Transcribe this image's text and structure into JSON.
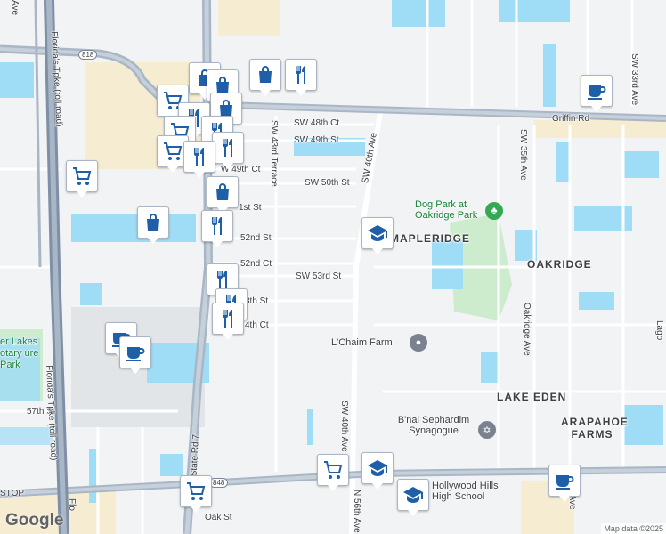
{
  "map": {
    "colors": {
      "land": "#f1f3f4",
      "water": "#9fdcf6",
      "road": "#ffffff",
      "highway": "#a9b6c6",
      "park": "#cdeccd",
      "urban": "#f6ecd1",
      "poi_blue": "#1e5fa8",
      "park_green": "#34a853"
    },
    "streets": {
      "sw48": "SW 48th Ct",
      "sw49": "SW 49th St",
      "sw49ct": "W 49th Ct",
      "sw50": "SW 50th St",
      "sw51": "1st St",
      "sw52": "52nd St",
      "sw52ct": "52nd Ct",
      "sw53": "SW 53rd St",
      "sw53b": "3th St",
      "sw54": "4th Ct",
      "sw57": "57th St",
      "sw43t": "SW 43rd Terrace",
      "sw40a": "SW 40th Ave",
      "sw40b": "SW 40th Ave",
      "sw35": "SW 35th Ave",
      "sw33": "SW 33rd Ave",
      "n56": "N 56th Ave",
      "nstate": "N State Rd 7",
      "griffin": "Griffin Rd",
      "oakridgeave": "Oakridge Ave",
      "ftp1": "Florida's Tpke (toll road)",
      "ftp2": "Florida's Tpke (toll road)",
      "ftp3": "Flo",
      "oak": "Oak St",
      "ave": "Ave",
      "lag": "Lago",
      "sthave": "th Ave",
      "r818": "818",
      "r848": "848"
    },
    "places": {
      "dogpark": "Dog Park at Oakridge Park",
      "mapleridge": "MAPLERIDGE",
      "oakridge": "OAKRIDGE",
      "lakeeden": "LAKE EDEN",
      "arapahoe": "ARAPAHOE FARMS",
      "chaim": "L'Chaim Farm",
      "bnai": "B'nai Sephardim Synagogue",
      "hollywoodhills": "Hollywood Hills High School",
      "lakes": "er Lakes otary ure Park",
      "stop": "STOP"
    },
    "icons": [
      "shopping-bag-icon",
      "restaurant-icon",
      "shopping-cart-icon",
      "coffee-icon",
      "school-icon"
    ],
    "google_logo": "Google",
    "attribution": "Map data ©2025"
  }
}
